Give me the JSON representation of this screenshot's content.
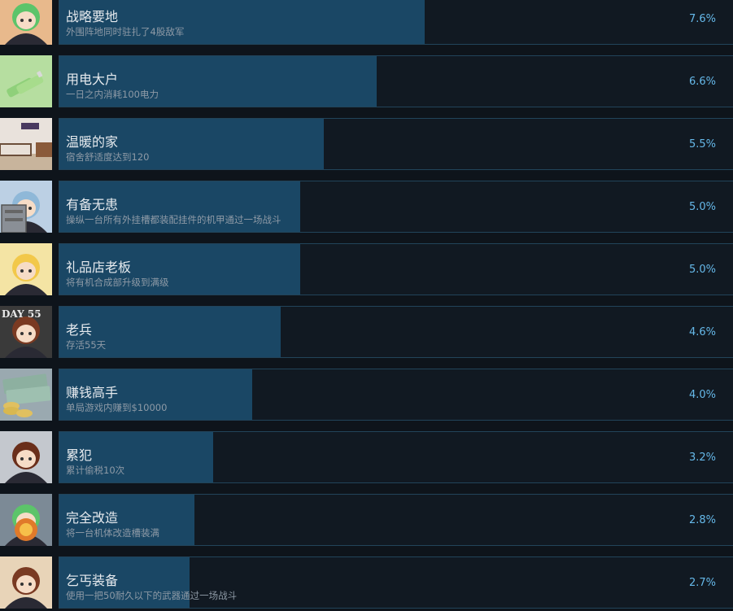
{
  "achievements": [
    {
      "title": "战略要地",
      "description": "外围阵地同时驻扎了4股敌军",
      "percent": "7.6%",
      "percent_value": 7.6,
      "icon": "achievement-icon-strategic-point",
      "icon_bg": "#e8b98c"
    },
    {
      "title": "用电大户",
      "description": "一日之内消耗100电力",
      "percent": "6.6%",
      "percent_value": 6.6,
      "icon": "achievement-icon-battery",
      "icon_bg": "#b6dea0"
    },
    {
      "title": "温暖的家",
      "description": "宿舍舒适度达到120",
      "percent": "5.5%",
      "percent_value": 5.5,
      "icon": "achievement-icon-dorm-room",
      "icon_bg": "#e9e2dc"
    },
    {
      "title": "有备无患",
      "description": "操纵一台所有外挂槽都装配挂件的机甲通过一场战斗",
      "percent": "5.0%",
      "percent_value": 5.0,
      "icon": "achievement-icon-mech-pilot",
      "icon_bg": "#bcd0e4"
    },
    {
      "title": "礼品店老板",
      "description": "将有机合成部升级到满级",
      "percent": "5.0%",
      "percent_value": 5.0,
      "icon": "achievement-icon-witch",
      "icon_bg": "#f4e4a4"
    },
    {
      "title": "老兵",
      "description": "存活55天",
      "percent": "4.6%",
      "percent_value": 4.6,
      "icon": "achievement-icon-veteran-day-55",
      "icon_bg": "#3a3a3a",
      "icon_text": "DAY 55"
    },
    {
      "title": "赚钱高手",
      "description": "单局游戏内赚到$10000",
      "percent": "4.0%",
      "percent_value": 4.0,
      "icon": "achievement-icon-money",
      "icon_bg": "#9aa9b0"
    },
    {
      "title": "累犯",
      "description": "累计偷税10次",
      "percent": "3.2%",
      "percent_value": 3.2,
      "icon": "achievement-icon-repeat-offender",
      "icon_bg": "#c4c8ce"
    },
    {
      "title": "完全改造",
      "description": "将一台机体改造槽装满",
      "percent": "2.8%",
      "percent_value": 2.8,
      "icon": "achievement-icon-full-upgrade",
      "icon_bg": "#7c8a96"
    },
    {
      "title": "乞丐装备",
      "description": "使用一把50耐久以下的武器通过一场战斗",
      "percent": "2.7%",
      "percent_value": 2.7,
      "icon": "achievement-icon-beggar-gear",
      "icon_bg": "#e8d4b8"
    }
  ]
}
